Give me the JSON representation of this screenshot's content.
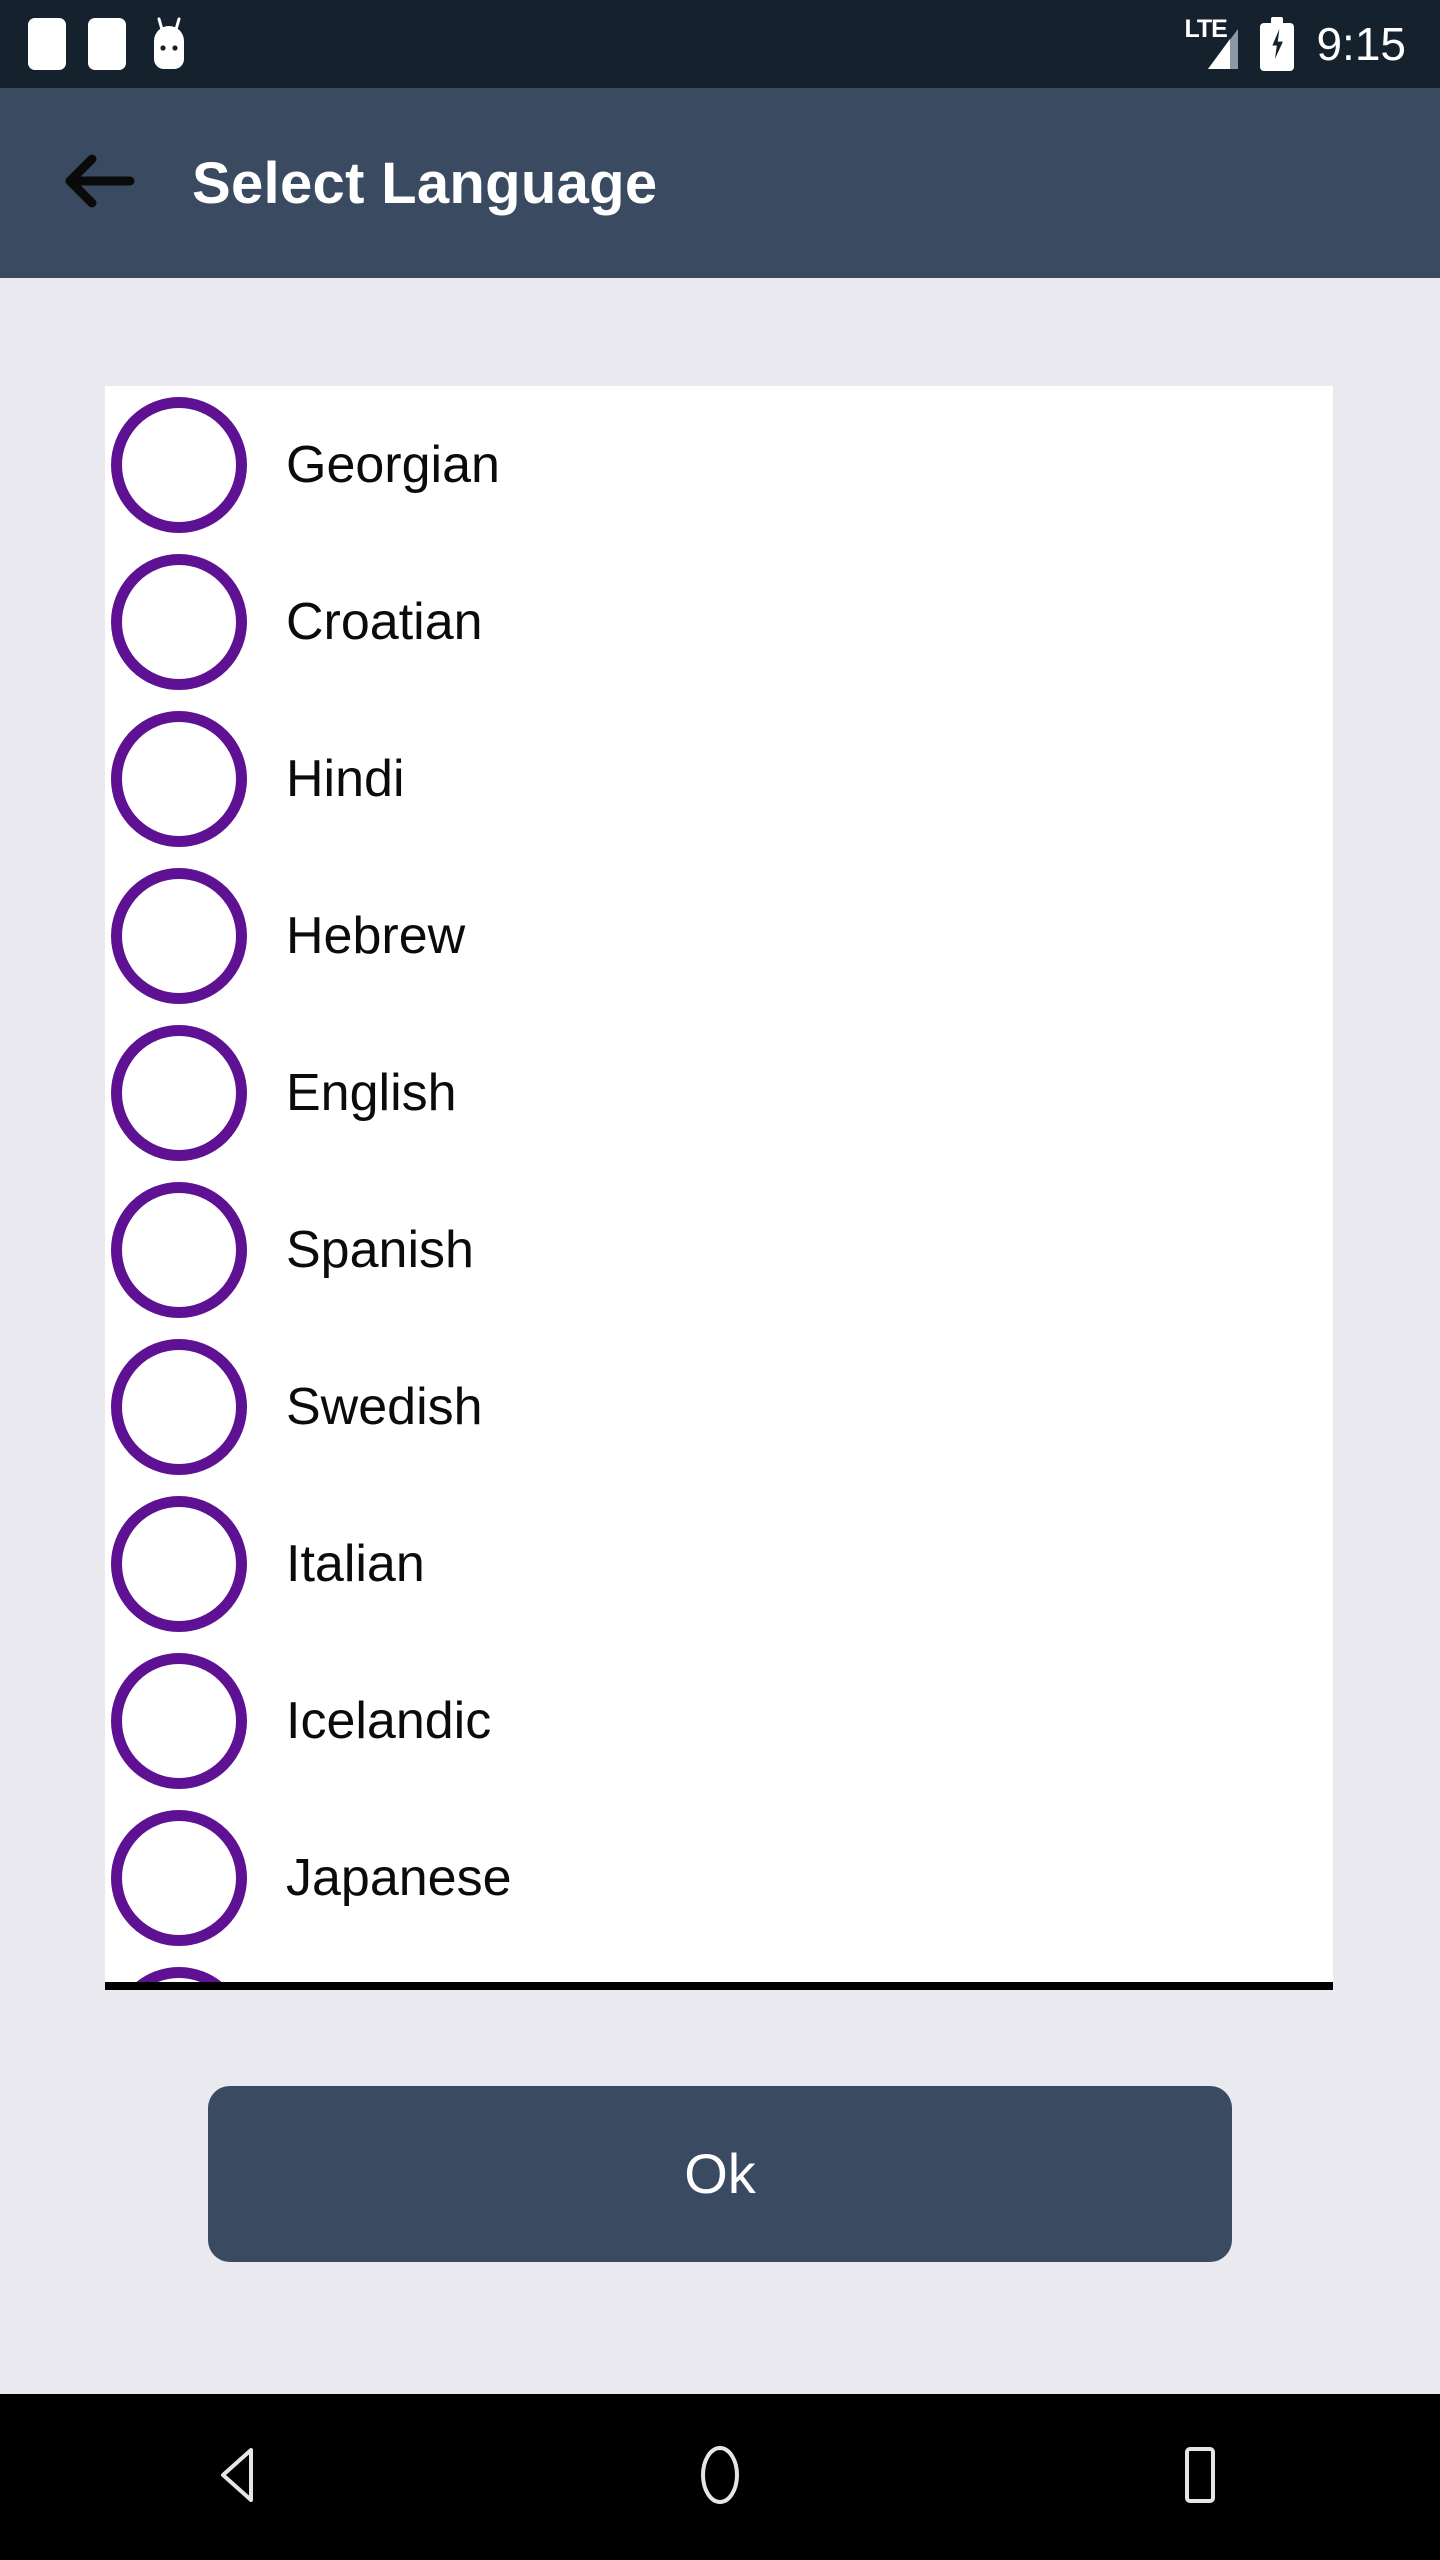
{
  "status_bar": {
    "background": "#16212e",
    "icons": [
      "notification-square-icon",
      "notification-square-icon",
      "android-robot-icon"
    ],
    "network_label": "LTE",
    "battery": "charging",
    "time": "9:15"
  },
  "app_bar": {
    "background": "#3a4a61",
    "back_icon": "arrow-left-icon",
    "title": "Select Language"
  },
  "page": {
    "background": "#e9e9ef",
    "card_background": "#ffffff",
    "radio_color": "#5f1193"
  },
  "language_list": {
    "items": [
      {
        "label": "Georgian",
        "selected": false
      },
      {
        "label": "Croatian",
        "selected": false
      },
      {
        "label": "Hindi",
        "selected": false
      },
      {
        "label": "Hebrew",
        "selected": false
      },
      {
        "label": "English",
        "selected": false
      },
      {
        "label": "Spanish",
        "selected": false
      },
      {
        "label": "Swedish",
        "selected": false
      },
      {
        "label": "Italian",
        "selected": false
      },
      {
        "label": "Icelandic",
        "selected": false
      },
      {
        "label": "Japanese",
        "selected": false
      },
      {
        "label": "",
        "selected": false
      }
    ]
  },
  "footer": {
    "ok_label": "Ok",
    "ok_background": "#3a4a61"
  },
  "nav_bar": {
    "background": "#000000",
    "buttons": [
      "back-triangle-icon",
      "home-circle-icon",
      "recents-square-icon"
    ]
  }
}
